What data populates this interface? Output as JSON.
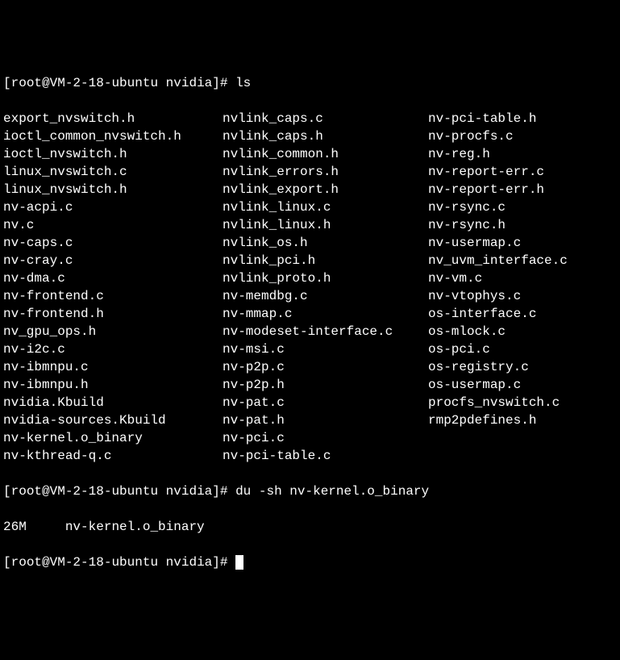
{
  "prompt1": {
    "user": "root",
    "host": "VM-2-18-ubuntu",
    "cwd": "nvidia",
    "command": "ls"
  },
  "ls_columns": {
    "col1": [
      "export_nvswitch.h",
      "ioctl_common_nvswitch.h",
      "ioctl_nvswitch.h",
      "linux_nvswitch.c",
      "linux_nvswitch.h",
      "nv-acpi.c",
      "nv.c",
      "nv-caps.c",
      "nv-cray.c",
      "nv-dma.c",
      "nv-frontend.c",
      "nv-frontend.h",
      "nv_gpu_ops.h",
      "nv-i2c.c",
      "nv-ibmnpu.c",
      "nv-ibmnpu.h",
      "nvidia.Kbuild",
      "nvidia-sources.Kbuild",
      "nv-kernel.o_binary",
      "nv-kthread-q.c"
    ],
    "col2": [
      "nvlink_caps.c",
      "nvlink_caps.h",
      "nvlink_common.h",
      "nvlink_errors.h",
      "nvlink_export.h",
      "nvlink_linux.c",
      "nvlink_linux.h",
      "nvlink_os.h",
      "nvlink_pci.h",
      "nvlink_proto.h",
      "nv-memdbg.c",
      "nv-mmap.c",
      "nv-modeset-interface.c",
      "nv-msi.c",
      "nv-p2p.c",
      "nv-p2p.h",
      "nv-pat.c",
      "nv-pat.h",
      "nv-pci.c",
      "nv-pci-table.c"
    ],
    "col3": [
      "nv-pci-table.h",
      "nv-procfs.c",
      "nv-reg.h",
      "nv-report-err.c",
      "nv-report-err.h",
      "nv-rsync.c",
      "nv-rsync.h",
      "nv-usermap.c",
      "nv_uvm_interface.c",
      "nv-vm.c",
      "nv-vtophys.c",
      "os-interface.c",
      "os-mlock.c",
      "os-pci.c",
      "os-registry.c",
      "os-usermap.c",
      "procfs_nvswitch.c",
      "rmp2pdefines.h",
      "",
      ""
    ]
  },
  "prompt2": {
    "user": "root",
    "host": "VM-2-18-ubuntu",
    "cwd": "nvidia",
    "command": "du -sh nv-kernel.o_binary"
  },
  "du_output": {
    "size": "26M",
    "file": "nv-kernel.o_binary"
  },
  "prompt3": {
    "user": "root",
    "host": "VM-2-18-ubuntu",
    "cwd": "nvidia"
  }
}
